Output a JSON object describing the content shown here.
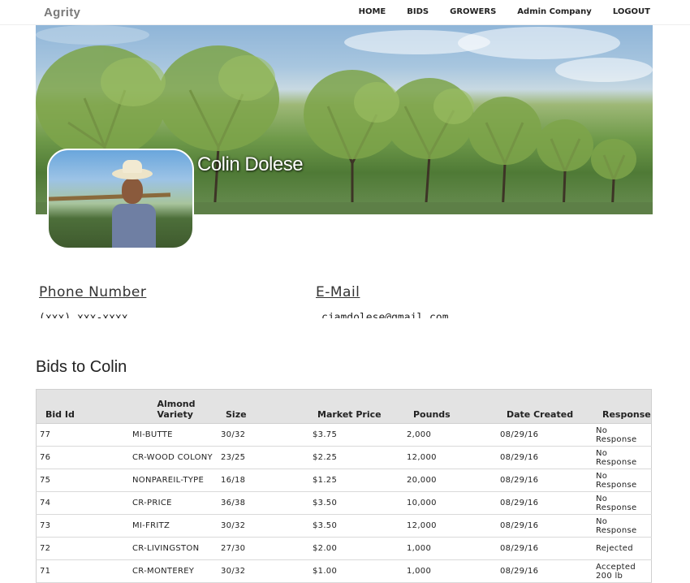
{
  "app": {
    "brand": "Agrity"
  },
  "nav": {
    "items": [
      {
        "label": "HOME"
      },
      {
        "label": "BIDS"
      },
      {
        "label": "GROWERS"
      },
      {
        "label": "Admin Company"
      },
      {
        "label": "LOGOUT"
      }
    ]
  },
  "profile": {
    "name": "Colin Dolese"
  },
  "contact": {
    "phone_label": "Phone Number",
    "phone_value": "(xxx) xxx-xxxx",
    "email_label": "E-Mail",
    "email_value": "cjamdolese@gmail.com"
  },
  "bids": {
    "title": "Bids to Colin",
    "columns": [
      "Bid Id",
      "Almond Variety",
      "Size",
      "Market Price",
      "Pounds",
      "Date Created",
      "Response"
    ],
    "rows": [
      {
        "id": "77",
        "variety": "MI-BUTTE",
        "size": "30/32",
        "price": "$3.75",
        "pounds": "2,000",
        "date": "08/29/16",
        "response": "No Response"
      },
      {
        "id": "76",
        "variety": "CR-WOOD COLONY",
        "size": "23/25",
        "price": "$2.25",
        "pounds": "12,000",
        "date": "08/29/16",
        "response": "No Response"
      },
      {
        "id": "75",
        "variety": "NONPAREIL-TYPE",
        "size": "16/18",
        "price": "$1.25",
        "pounds": "20,000",
        "date": "08/29/16",
        "response": "No Response"
      },
      {
        "id": "74",
        "variety": "CR-PRICE",
        "size": "36/38",
        "price": "$3.50",
        "pounds": "10,000",
        "date": "08/29/16",
        "response": "No Response"
      },
      {
        "id": "73",
        "variety": "MI-FRITZ",
        "size": "30/32",
        "price": "$3.50",
        "pounds": "12,000",
        "date": "08/29/16",
        "response": "No Response"
      },
      {
        "id": "72",
        "variety": "CR-LIVINGSTON",
        "size": "27/30",
        "price": "$2.00",
        "pounds": "1,000",
        "date": "08/29/16",
        "response": "Rejected"
      },
      {
        "id": "71",
        "variety": "CR-MONTEREY",
        "size": "30/32",
        "price": "$1.00",
        "pounds": "1,000",
        "date": "08/29/16",
        "response": "Accepted 200 lb"
      }
    ]
  }
}
